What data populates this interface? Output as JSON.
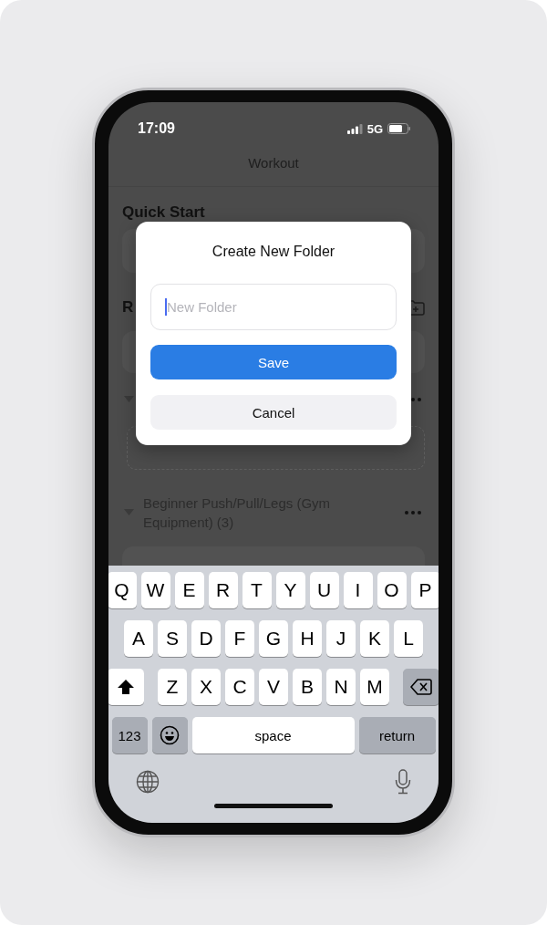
{
  "status_bar": {
    "time": "17:09",
    "network": "5G"
  },
  "nav": {
    "title": "Workout"
  },
  "quick_start": {
    "heading": "Quick Start"
  },
  "routines": {
    "heading": "R"
  },
  "folders": [
    {
      "expanded": true
    },
    {
      "name": "Beginner Push/Pull/Legs (Gym Equipment) (3)",
      "expanded": true
    }
  ],
  "dialog": {
    "title": "Create New Folder",
    "field": {
      "placeholder": "New Folder"
    },
    "buttons": [
      {
        "label": "Save",
        "kind": "primary"
      },
      {
        "label": "Cancel",
        "kind": "secondary"
      }
    ]
  },
  "keyboard": {
    "letter_rows": [
      {
        "keys": [
          "Q",
          "W",
          "E",
          "R",
          "T",
          "Y",
          "U",
          "I",
          "O",
          "P"
        ]
      },
      {
        "keys": [
          "A",
          "S",
          "D",
          "F",
          "G",
          "H",
          "J",
          "K",
          "L"
        ]
      },
      {
        "keys": [
          "Z",
          "X",
          "C",
          "V",
          "B",
          "N",
          "M"
        ]
      }
    ],
    "numbers_key": "123",
    "space_key": "space",
    "return_key": "return"
  }
}
